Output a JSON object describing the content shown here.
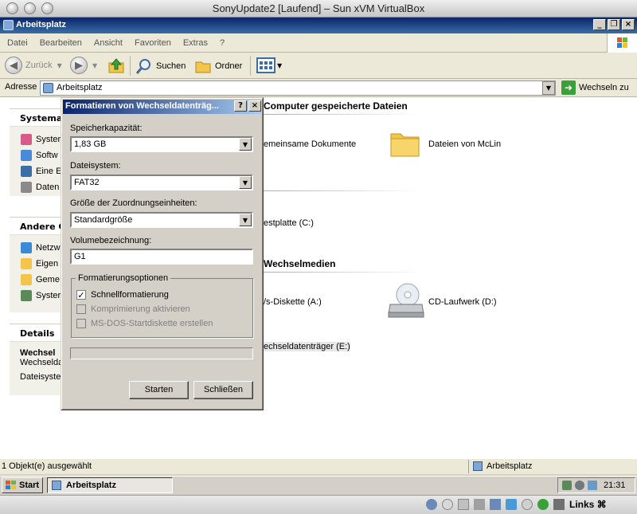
{
  "vm_window": {
    "title": "SonyUpdate2 [Laufend] – Sun xVM VirtualBox"
  },
  "explorer": {
    "title": "Arbeitsplatz",
    "menu": [
      "Datei",
      "Bearbeiten",
      "Ansicht",
      "Favoriten",
      "Extras",
      "?"
    ],
    "toolbar": {
      "back": "Zurück",
      "search": "Suchen",
      "folders": "Ordner"
    },
    "address": {
      "label": "Adresse",
      "value": "Arbeitsplatz",
      "go": "Wechseln zu"
    },
    "tasks": {
      "system": {
        "title": "Systema",
        "items": [
          "Syster",
          "Softw",
          "Eine E",
          "Daten"
        ]
      },
      "other": {
        "title": "Andere C",
        "items": [
          "Netzw",
          "Eigen",
          "Geme",
          "Syster"
        ]
      },
      "details": {
        "title": "Details",
        "name": "Wechsel",
        "type": "Wechselda",
        "fs": "Dateisyste"
      }
    },
    "sections": {
      "stored": {
        "title": "Computer gespeicherte Dateien",
        "items": [
          "emeinsame Dokumente",
          "Dateien von McLin"
        ]
      },
      "drives": {
        "items": [
          "estplatte (C:)"
        ]
      },
      "removable": {
        "title": "Wechselmedien",
        "items": [
          "/s-Diskette (A:)",
          "CD-Laufwerk (D:)",
          "echseldatenträger (E:)"
        ]
      }
    },
    "status": {
      "selection": "1 Objekt(e) ausgewählt",
      "location": "Arbeitsplatz"
    }
  },
  "dialog": {
    "title": "Formatieren von Wechseldatenträg...",
    "help": "?",
    "close": "×",
    "capacity": {
      "label": "Speicherkapazität:",
      "value": "1,83 GB"
    },
    "filesystem": {
      "label": "Dateisystem:",
      "value": "FAT32"
    },
    "alloc": {
      "label": "Größe der Zuordnungseinheiten:",
      "value": "Standardgröße"
    },
    "volume": {
      "label": "Volumebezeichnung:",
      "value": "G1"
    },
    "options": {
      "title": "Formatierungsoptionen",
      "quick": {
        "label": "Schnellformatierung",
        "checked": true
      },
      "compress": {
        "label": "Komprimierung aktivieren",
        "checked": false
      },
      "msdos": {
        "label": "MS-DOS-Startdiskette erstellen",
        "checked": false
      }
    },
    "progress": 0,
    "start": "Starten",
    "close_btn": "Schließen"
  },
  "taskbar": {
    "start": "Start",
    "task": "Arbeitsplatz",
    "clock": "21:31"
  },
  "vbox": {
    "host_key": "Links ⌘"
  },
  "colors": {
    "xp_blue": "#0a246a",
    "accent": "#3a6ea5",
    "folder": "#f3c54a"
  }
}
